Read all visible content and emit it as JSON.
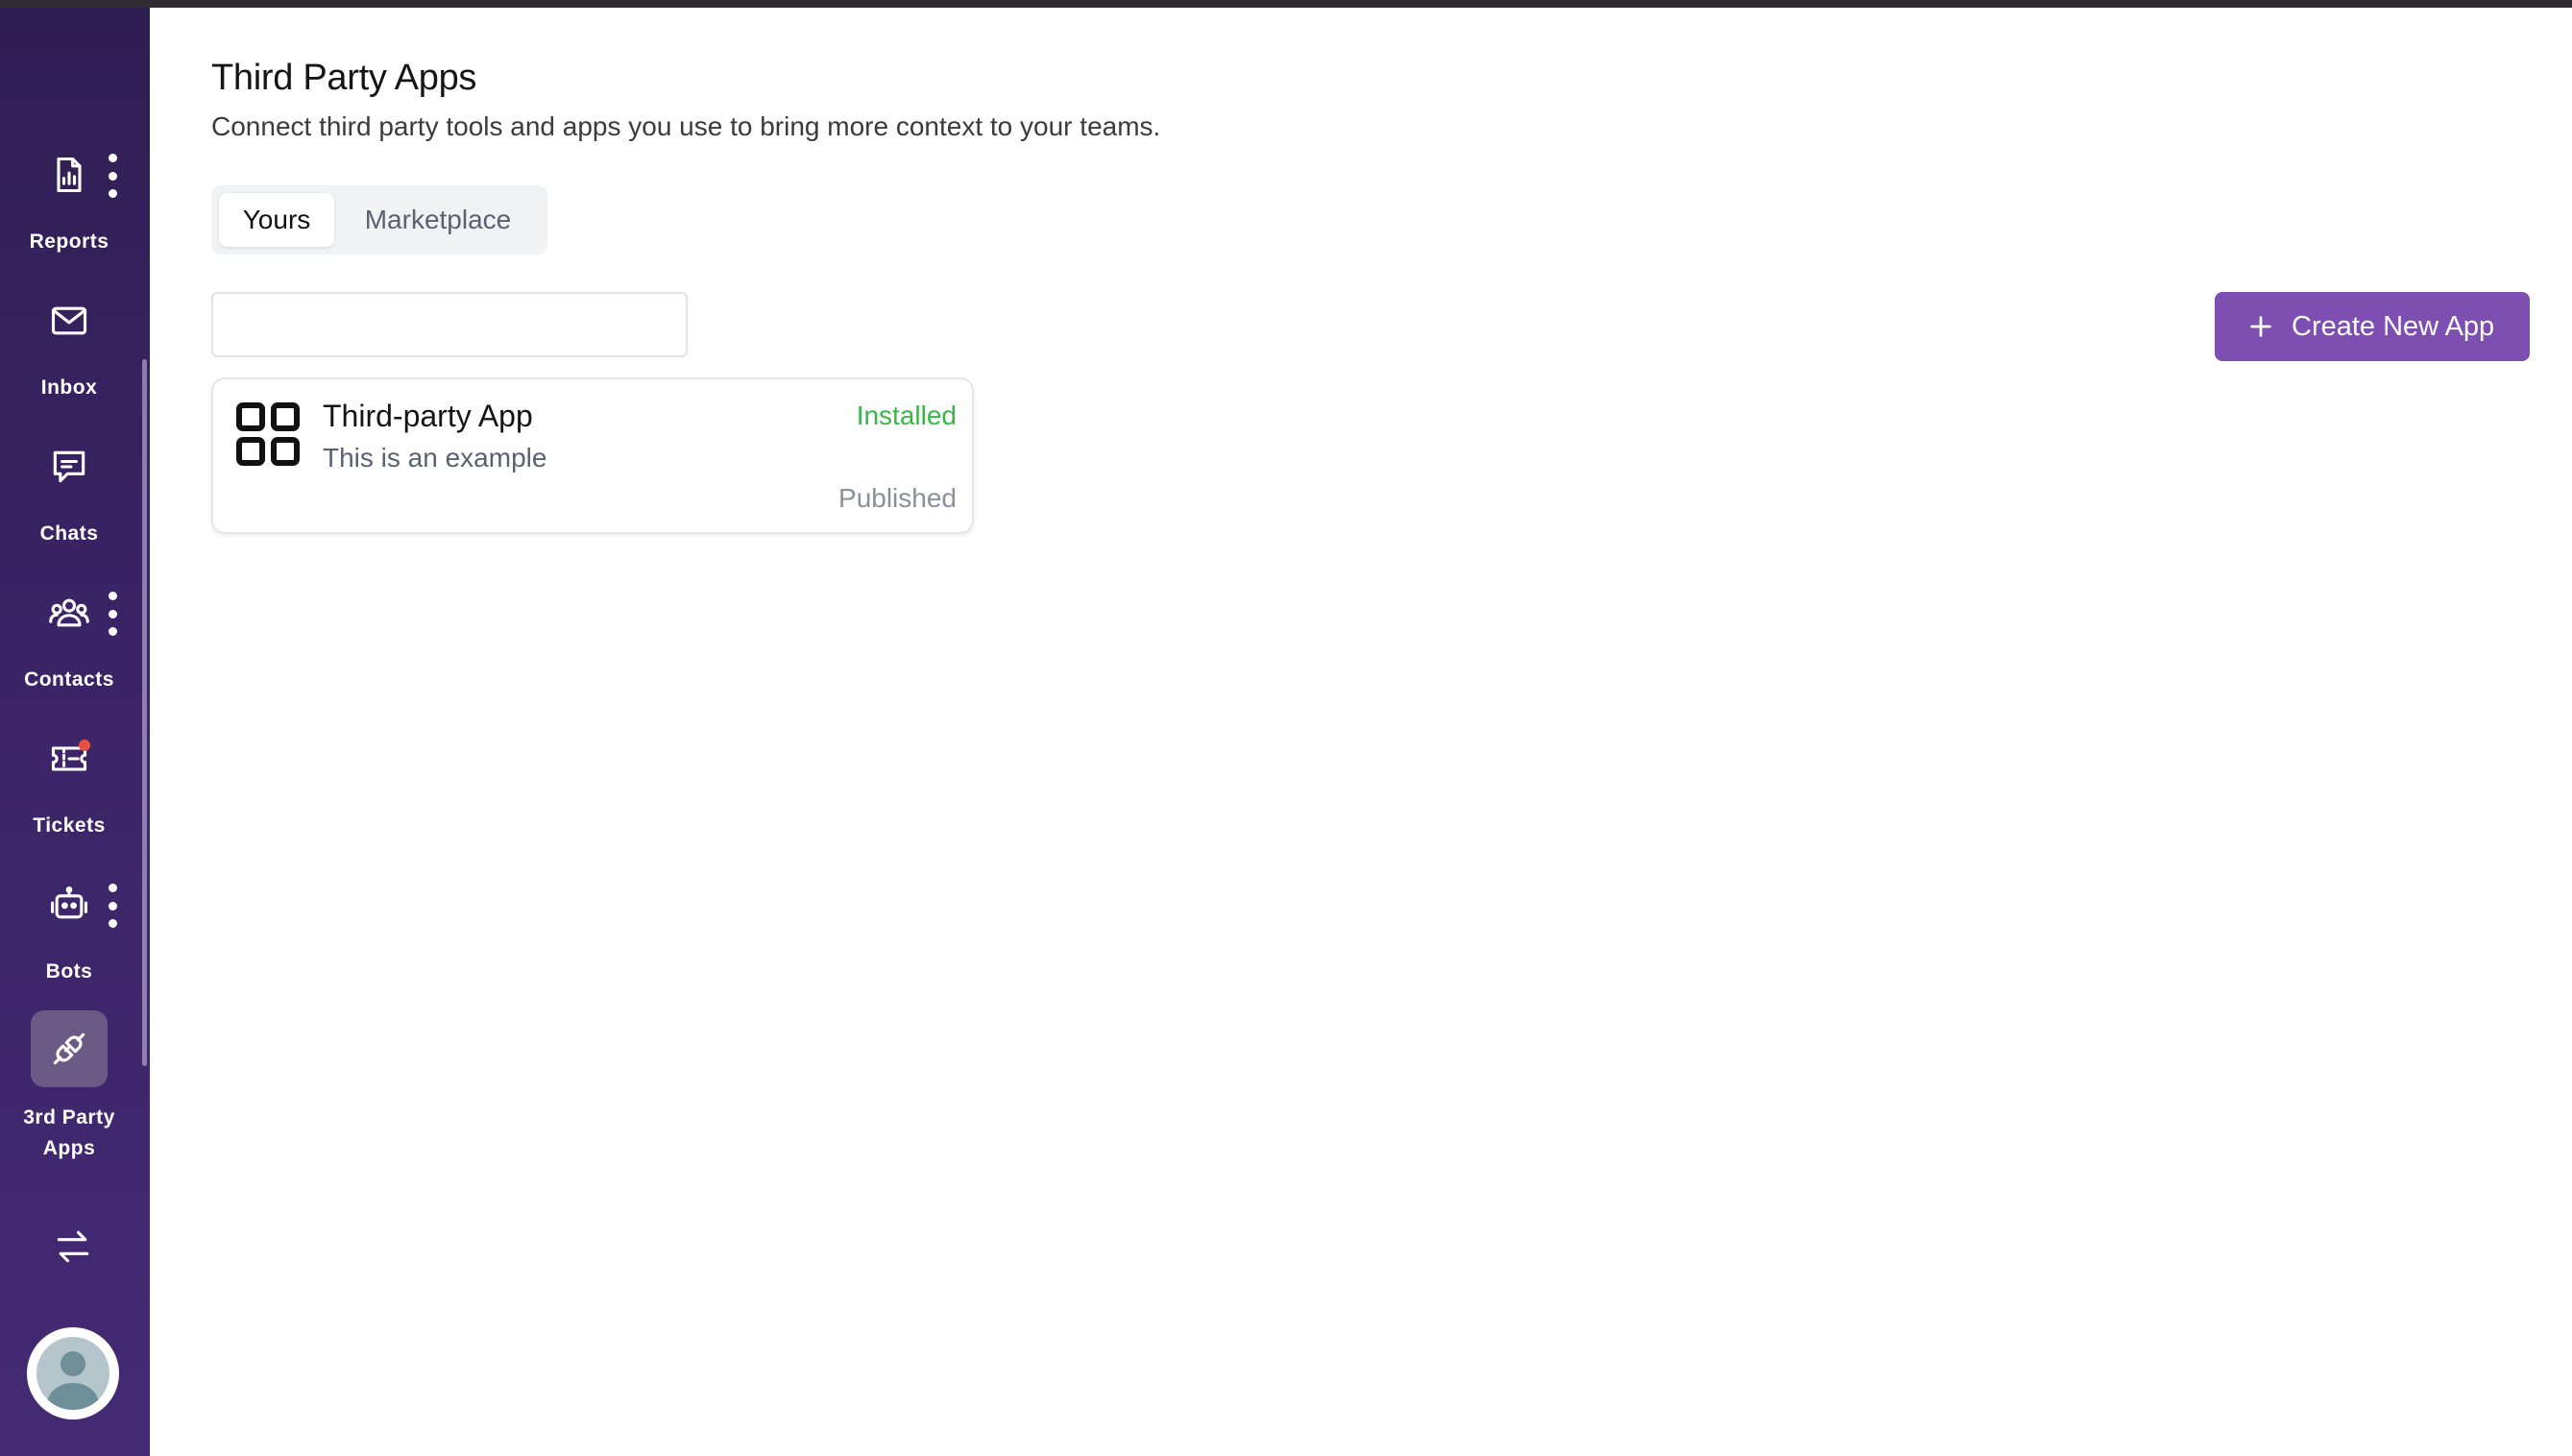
{
  "colors": {
    "sidebar_bg": "#3b2466",
    "accent": "#7c4fb0",
    "installed": "#39b54a",
    "published": "#8a8f99",
    "notification": "#e8503f"
  },
  "sidebar": {
    "items": [
      {
        "label": "Reports",
        "icon": "reports-icon",
        "has_menu": true
      },
      {
        "label": "Inbox",
        "icon": "mail-icon",
        "has_menu": false
      },
      {
        "label": "Chats",
        "icon": "chat-icon",
        "has_menu": false
      },
      {
        "label": "Contacts",
        "icon": "contacts-icon",
        "has_menu": true
      },
      {
        "label": "Tickets",
        "icon": "ticket-icon",
        "has_menu": false,
        "notification": true
      },
      {
        "label": "Bots",
        "icon": "bot-icon",
        "has_menu": true
      },
      {
        "label": "3rd Party Apps",
        "label_line1": "3rd Party",
        "label_line2": "Apps",
        "icon": "plug-icon",
        "active": true
      }
    ],
    "switch_icon": "swap-arrows-icon",
    "avatar_icon": "user-avatar-icon"
  },
  "header": {
    "title": "Third Party Apps",
    "subtitle": "Connect third party tools and apps you use to bring more context to your teams."
  },
  "tabs": [
    {
      "label": "Yours",
      "active": true
    },
    {
      "label": "Marketplace",
      "active": false
    }
  ],
  "search": {
    "value": "",
    "placeholder": ""
  },
  "create_button": {
    "label": "Create New App",
    "icon": "plus-icon"
  },
  "apps": [
    {
      "name": "Third-party App",
      "description": "This is an example",
      "status": "Installed",
      "visibility": "Published",
      "icon": "grid-icon"
    }
  ]
}
